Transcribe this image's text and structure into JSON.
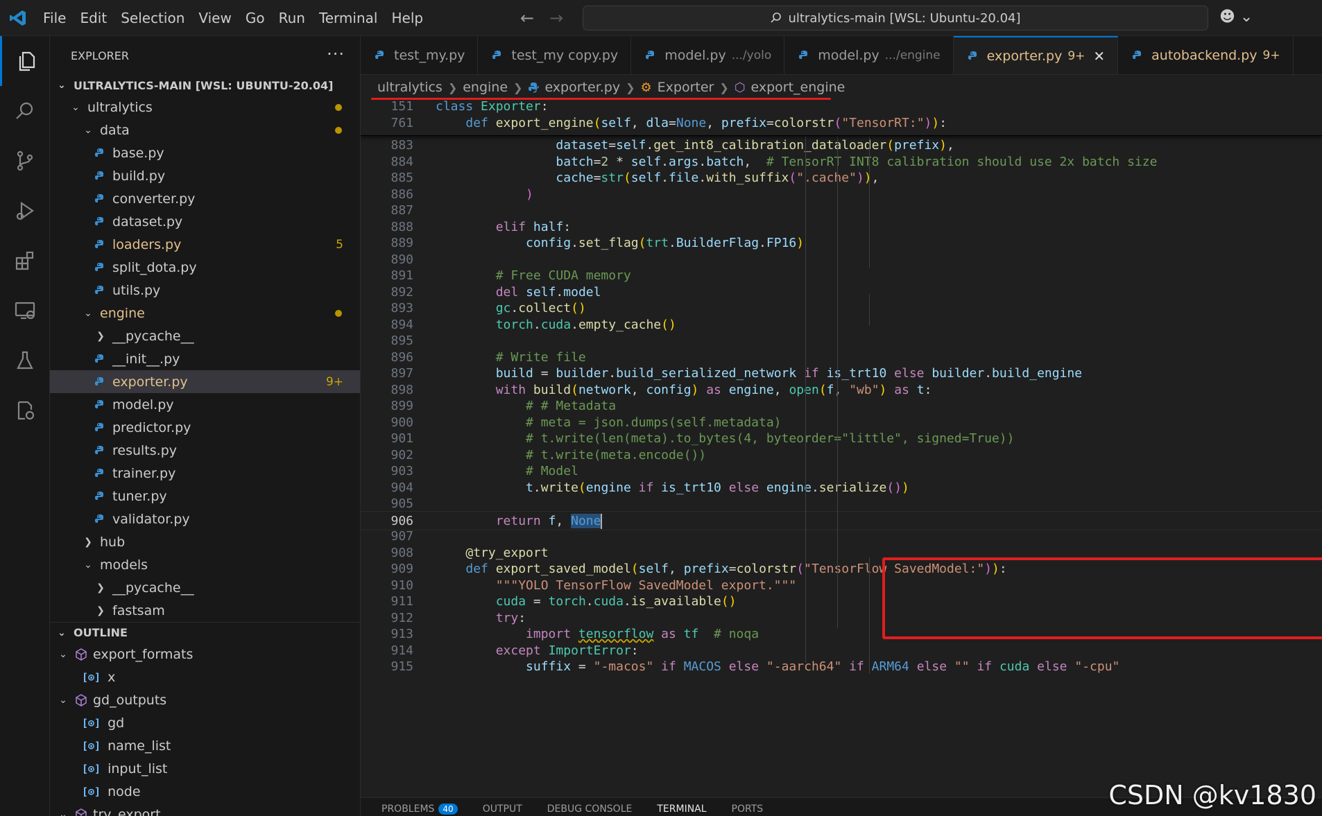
{
  "titlebar": {
    "menu": [
      "File",
      "Edit",
      "Selection",
      "View",
      "Go",
      "Run",
      "Terminal",
      "Help"
    ],
    "search_text": "ultralytics-main [WSL: Ubuntu-20.04]"
  },
  "explorer": {
    "title": "EXPLORER",
    "more": "···",
    "root": "ULTRALYTICS-MAIN [WSL: UBUNTU-20.04]",
    "tree": [
      {
        "label": "ultralytics",
        "type": "folder",
        "open": true,
        "level": 1,
        "dot": true
      },
      {
        "label": "data",
        "type": "folder",
        "open": true,
        "level": 2,
        "dot": true
      },
      {
        "label": "base.py",
        "type": "file",
        "level": 3
      },
      {
        "label": "build.py",
        "type": "file",
        "level": 3
      },
      {
        "label": "converter.py",
        "type": "file",
        "level": 3
      },
      {
        "label": "dataset.py",
        "type": "file",
        "level": 3
      },
      {
        "label": "loaders.py",
        "type": "file",
        "level": 3,
        "badge": "5",
        "yellow": true
      },
      {
        "label": "split_dota.py",
        "type": "file",
        "level": 3
      },
      {
        "label": "utils.py",
        "type": "file",
        "level": 3
      },
      {
        "label": "engine",
        "type": "folder",
        "open": true,
        "level": 2,
        "dot": true,
        "yellow": true
      },
      {
        "label": "__pycache__",
        "type": "folder",
        "open": false,
        "level": 3
      },
      {
        "label": "__init__.py",
        "type": "file",
        "level": 3
      },
      {
        "label": "exporter.py",
        "type": "file",
        "level": 3,
        "badge": "9+",
        "yellow": true,
        "selected": true
      },
      {
        "label": "model.py",
        "type": "file",
        "level": 3
      },
      {
        "label": "predictor.py",
        "type": "file",
        "level": 3
      },
      {
        "label": "results.py",
        "type": "file",
        "level": 3
      },
      {
        "label": "trainer.py",
        "type": "file",
        "level": 3
      },
      {
        "label": "tuner.py",
        "type": "file",
        "level": 3
      },
      {
        "label": "validator.py",
        "type": "file",
        "level": 3
      },
      {
        "label": "hub",
        "type": "folder",
        "open": false,
        "level": 2
      },
      {
        "label": "models",
        "type": "folder",
        "open": true,
        "level": 2
      },
      {
        "label": "__pycache__",
        "type": "folder",
        "open": false,
        "level": 3
      },
      {
        "label": "fastsam",
        "type": "folder",
        "open": false,
        "level": 3
      }
    ]
  },
  "outline": {
    "title": "OUTLINE",
    "items": [
      {
        "label": "export_formats",
        "kind": "module",
        "level": 1,
        "open": true
      },
      {
        "label": "x",
        "kind": "variable",
        "level": 2
      },
      {
        "label": "gd_outputs",
        "kind": "module",
        "level": 1,
        "open": true
      },
      {
        "label": "gd",
        "kind": "variable",
        "level": 2
      },
      {
        "label": "name_list",
        "kind": "variable",
        "level": 2
      },
      {
        "label": "input_list",
        "kind": "variable",
        "level": 2
      },
      {
        "label": "node",
        "kind": "variable",
        "level": 2
      },
      {
        "label": "try_export",
        "kind": "module",
        "level": 1,
        "open": true
      }
    ]
  },
  "tabs": [
    {
      "label": "test_my.py",
      "desc": "",
      "badge": "",
      "active": false
    },
    {
      "label": "test_my copy.py",
      "desc": "",
      "badge": "",
      "active": false
    },
    {
      "label": "model.py",
      "desc": ".../yolo",
      "badge": "",
      "active": false
    },
    {
      "label": "model.py",
      "desc": ".../engine",
      "badge": "",
      "active": false
    },
    {
      "label": "exporter.py",
      "desc": "",
      "badge": "9+",
      "active": true,
      "close": "✕"
    },
    {
      "label": "autobackend.py",
      "desc": "",
      "badge": "9+",
      "active": false
    }
  ],
  "breadcrumb": [
    "ultralytics",
    "engine",
    "exporter.py",
    "Exporter",
    "export_engine"
  ],
  "editor": {
    "sticky": [
      {
        "n": "151",
        "code": "class Exporter:"
      },
      {
        "n": "761",
        "code": "    def export_engine(self, dla=None, prefix=colorstr(\"TensorRT:\")):"
      }
    ],
    "lines": [
      {
        "n": "883",
        "code": "                dataset=self.get_int8_calibration_dataloader(prefix),"
      },
      {
        "n": "884",
        "code": "                batch=2 * self.args.batch,  # TensorRT INT8 calibration should use 2x batch size"
      },
      {
        "n": "885",
        "code": "                cache=str(self.file.with_suffix(\".cache\")),"
      },
      {
        "n": "886",
        "code": "            )"
      },
      {
        "n": "887",
        "code": ""
      },
      {
        "n": "888",
        "code": "        elif half:"
      },
      {
        "n": "889",
        "code": "            config.set_flag(trt.BuilderFlag.FP16)"
      },
      {
        "n": "890",
        "code": ""
      },
      {
        "n": "891",
        "code": "        # Free CUDA memory"
      },
      {
        "n": "892",
        "code": "        del self.model"
      },
      {
        "n": "893",
        "code": "        gc.collect()"
      },
      {
        "n": "894",
        "code": "        torch.cuda.empty_cache()"
      },
      {
        "n": "895",
        "code": ""
      },
      {
        "n": "896",
        "code": "        # Write file"
      },
      {
        "n": "897",
        "code": "        build = builder.build_serialized_network if is_trt10 else builder.build_engine"
      },
      {
        "n": "898",
        "code": "        with build(network, config) as engine, open(f, \"wb\") as t:"
      },
      {
        "n": "899",
        "code": "            # # Metadata"
      },
      {
        "n": "900",
        "code": "            # meta = json.dumps(self.metadata)"
      },
      {
        "n": "901",
        "code": "            # t.write(len(meta).to_bytes(4, byteorder=\"little\", signed=True))"
      },
      {
        "n": "902",
        "code": "            # t.write(meta.encode())"
      },
      {
        "n": "903",
        "code": "            # Model"
      },
      {
        "n": "904",
        "code": "            t.write(engine if is_trt10 else engine.serialize())"
      },
      {
        "n": "905",
        "code": ""
      },
      {
        "n": "906",
        "code": "        return f, None"
      },
      {
        "n": "907",
        "code": ""
      },
      {
        "n": "908",
        "code": "    @try_export"
      },
      {
        "n": "909",
        "code": "    def export_saved_model(self, prefix=colorstr(\"TensorFlow SavedModel:\")):"
      },
      {
        "n": "910",
        "code": "        \"\"\"YOLO TensorFlow SavedModel export.\"\"\""
      },
      {
        "n": "911",
        "code": "        cuda = torch.cuda.is_available()"
      },
      {
        "n": "912",
        "code": "        try:"
      },
      {
        "n": "913",
        "code": "            import tensorflow as tf  # noqa"
      },
      {
        "n": "914",
        "code": "        except ImportError:"
      },
      {
        "n": "915",
        "code": "            suffix = \"-macos\" if MACOS else \"-aarch64\" if ARM64 else \"\" if cuda else \"-cpu\""
      }
    ],
    "current_line": "906"
  },
  "panel": {
    "tabs": [
      "PROBLEMS",
      "OUTPUT",
      "DEBUG CONSOLE",
      "TERMINAL",
      "PORTS"
    ],
    "problems_count": "40",
    "active": "TERMINAL"
  },
  "watermark": "CSDN @kv1830",
  "colors": {
    "accent": "#0078d4",
    "highlight_box": "#e01e1e",
    "modified": "#e2c08d"
  }
}
